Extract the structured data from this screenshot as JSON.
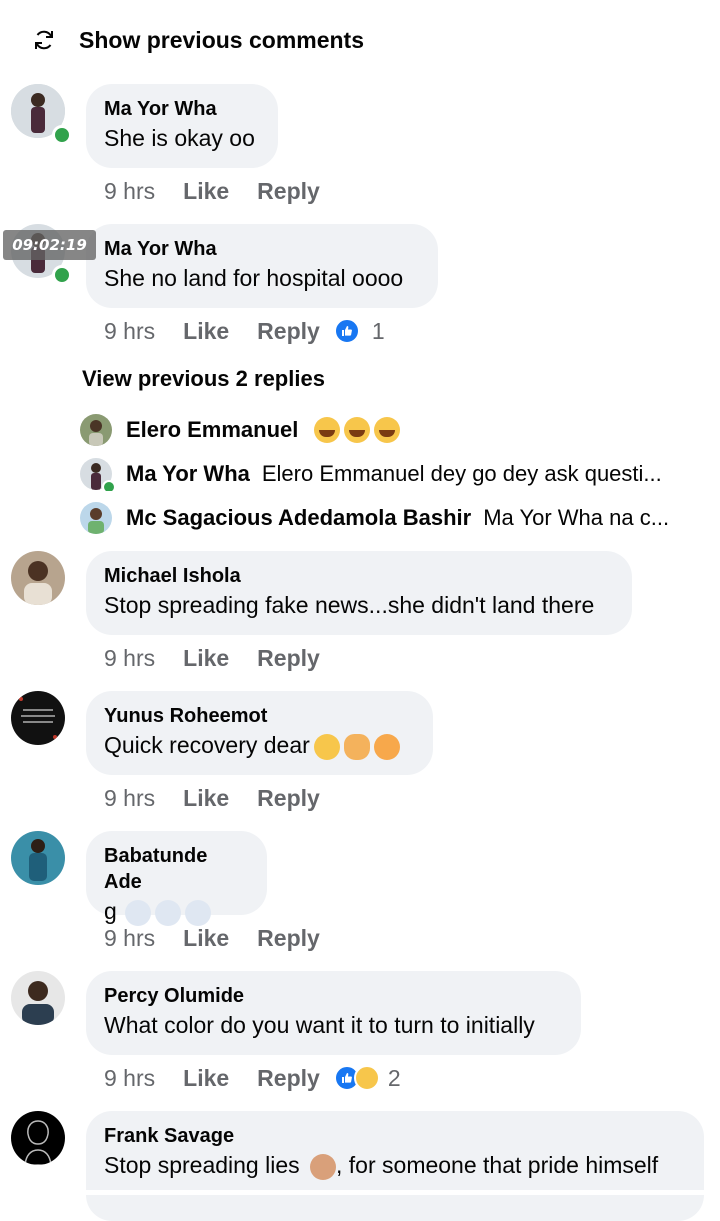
{
  "header": {
    "show_previous": "Show previous comments"
  },
  "comments": [
    {
      "name": "Ma Yor Wha",
      "text": "She is okay oo",
      "time": "9 hrs",
      "like": "Like",
      "reply": "Reply"
    },
    {
      "name": "Ma Yor Wha",
      "text": "She no land for hospital oooo",
      "time": "9 hrs",
      "like": "Like",
      "reply": "Reply",
      "reactions": "1"
    },
    {
      "name": "Michael Ishola",
      "text": "Stop spreading fake news...she didn't land there",
      "time": "9 hrs",
      "like": "Like",
      "reply": "Reply"
    },
    {
      "name": "Yunus Roheemot",
      "text": "Quick recovery dear",
      "time": "9 hrs",
      "like": "Like",
      "reply": "Reply"
    },
    {
      "name": "Babatunde Ade",
      "text": "g",
      "time": "9 hrs",
      "like": "Like",
      "reply": "Reply"
    },
    {
      "name": "Percy Olumide",
      "text": "What color do you want it to turn to initially",
      "time": "9 hrs",
      "like": "Like",
      "reply": "Reply",
      "reactions": "2"
    },
    {
      "name": "Frank Savage",
      "text": "Stop spreading lies",
      "text_after": ", for someone that pride himself"
    }
  ],
  "thread": {
    "view_previous": "View previous 2 replies",
    "replies": [
      {
        "name": "Elero Emmanuel",
        "text": ""
      },
      {
        "name": "Ma Yor Wha",
        "text": "Elero Emmanuel dey go dey ask questi..."
      },
      {
        "name": "Mc Sagacious Adedamola Bashir",
        "text": "Ma Yor Wha na c..."
      }
    ]
  },
  "overlay": {
    "timestamp": "09:02:19"
  },
  "colors": {
    "bubble": "#f0f2f5",
    "secondary_text": "#65676b",
    "like_blue": "#1877f2",
    "online_green": "#31a24c"
  }
}
